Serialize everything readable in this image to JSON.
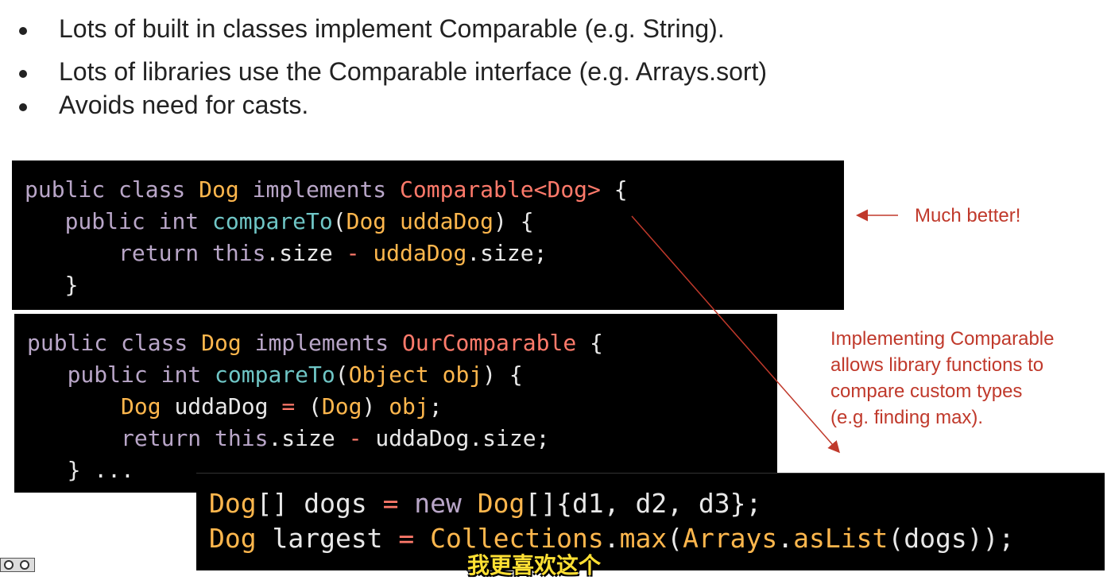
{
  "bullets": [
    "Lots of built in classes implement Comparable (e.g. String).",
    "Lots of libraries use the Comparable interface (e.g. Arrays.sort)",
    "Avoids need for casts."
  ],
  "code_block_1": {
    "line1": {
      "kw1": "public class ",
      "type": "Dog",
      "kw2": " implements ",
      "iface": "Comparable<Dog>",
      "rest": " {"
    },
    "line2": {
      "indent": "   ",
      "kw": "public int ",
      "fn": "compareTo",
      "p1": "(",
      "type": "Dog uddaDog",
      "rest": ") {"
    },
    "line3": {
      "indent": "       ",
      "kw": "return this",
      "rest1": ".size ",
      "op": "-",
      "var": " uddaDog",
      "rest2": ".size;"
    },
    "line4": {
      "indent": "   ",
      "rest": "}"
    }
  },
  "code_block_2": {
    "line1": {
      "kw1": "public class ",
      "type": "Dog",
      "kw2": " implements ",
      "iface": "OurComparable",
      "rest": " {"
    },
    "line2": {
      "indent": "   ",
      "kw": "public int ",
      "fn": "compareTo",
      "p1": "(",
      "type": "Object obj",
      "rest": ") {"
    },
    "line3": {
      "indent": "       ",
      "type": "Dog",
      "mid": " uddaDog ",
      "op": "=",
      "p1": " (",
      "type2": "Dog",
      "p2": ") ",
      "var": "obj",
      "rest": ";"
    },
    "line4": {
      "indent": "       ",
      "kw": "return this",
      "rest1": ".size ",
      "op": "-",
      "rest2": " uddaDog.size;"
    },
    "line5": {
      "indent": "   ",
      "rest": "} ..."
    }
  },
  "code_block_3": {
    "line1": {
      "type": "Dog",
      "p1": "[] dogs ",
      "op": "=",
      "kw": " new ",
      "type2": "Dog",
      "rest": "[]{d1, d2, d3};"
    },
    "line2": {
      "type": "Dog",
      "p1": " largest ",
      "op": "=",
      "sp": " ",
      "cls": "Collections",
      "p2": ".",
      "fn": "max",
      "p3": "(",
      "cls2": "Arrays",
      "p4": ".",
      "fn2": "asList",
      "rest": "(dogs));"
    }
  },
  "annotations": {
    "much_better": "Much better!",
    "implementing_lines": [
      "Implementing Comparable",
      "allows library functions to",
      "compare custom types",
      "(e.g. finding max)."
    ]
  },
  "subtitle": "我更喜欢这个",
  "colors": {
    "annotation": "#c0392b",
    "keyword": "#b9a6c8",
    "type": "#ffb74d",
    "function": "#6fc6c6",
    "interface": "#ff7a6b"
  }
}
